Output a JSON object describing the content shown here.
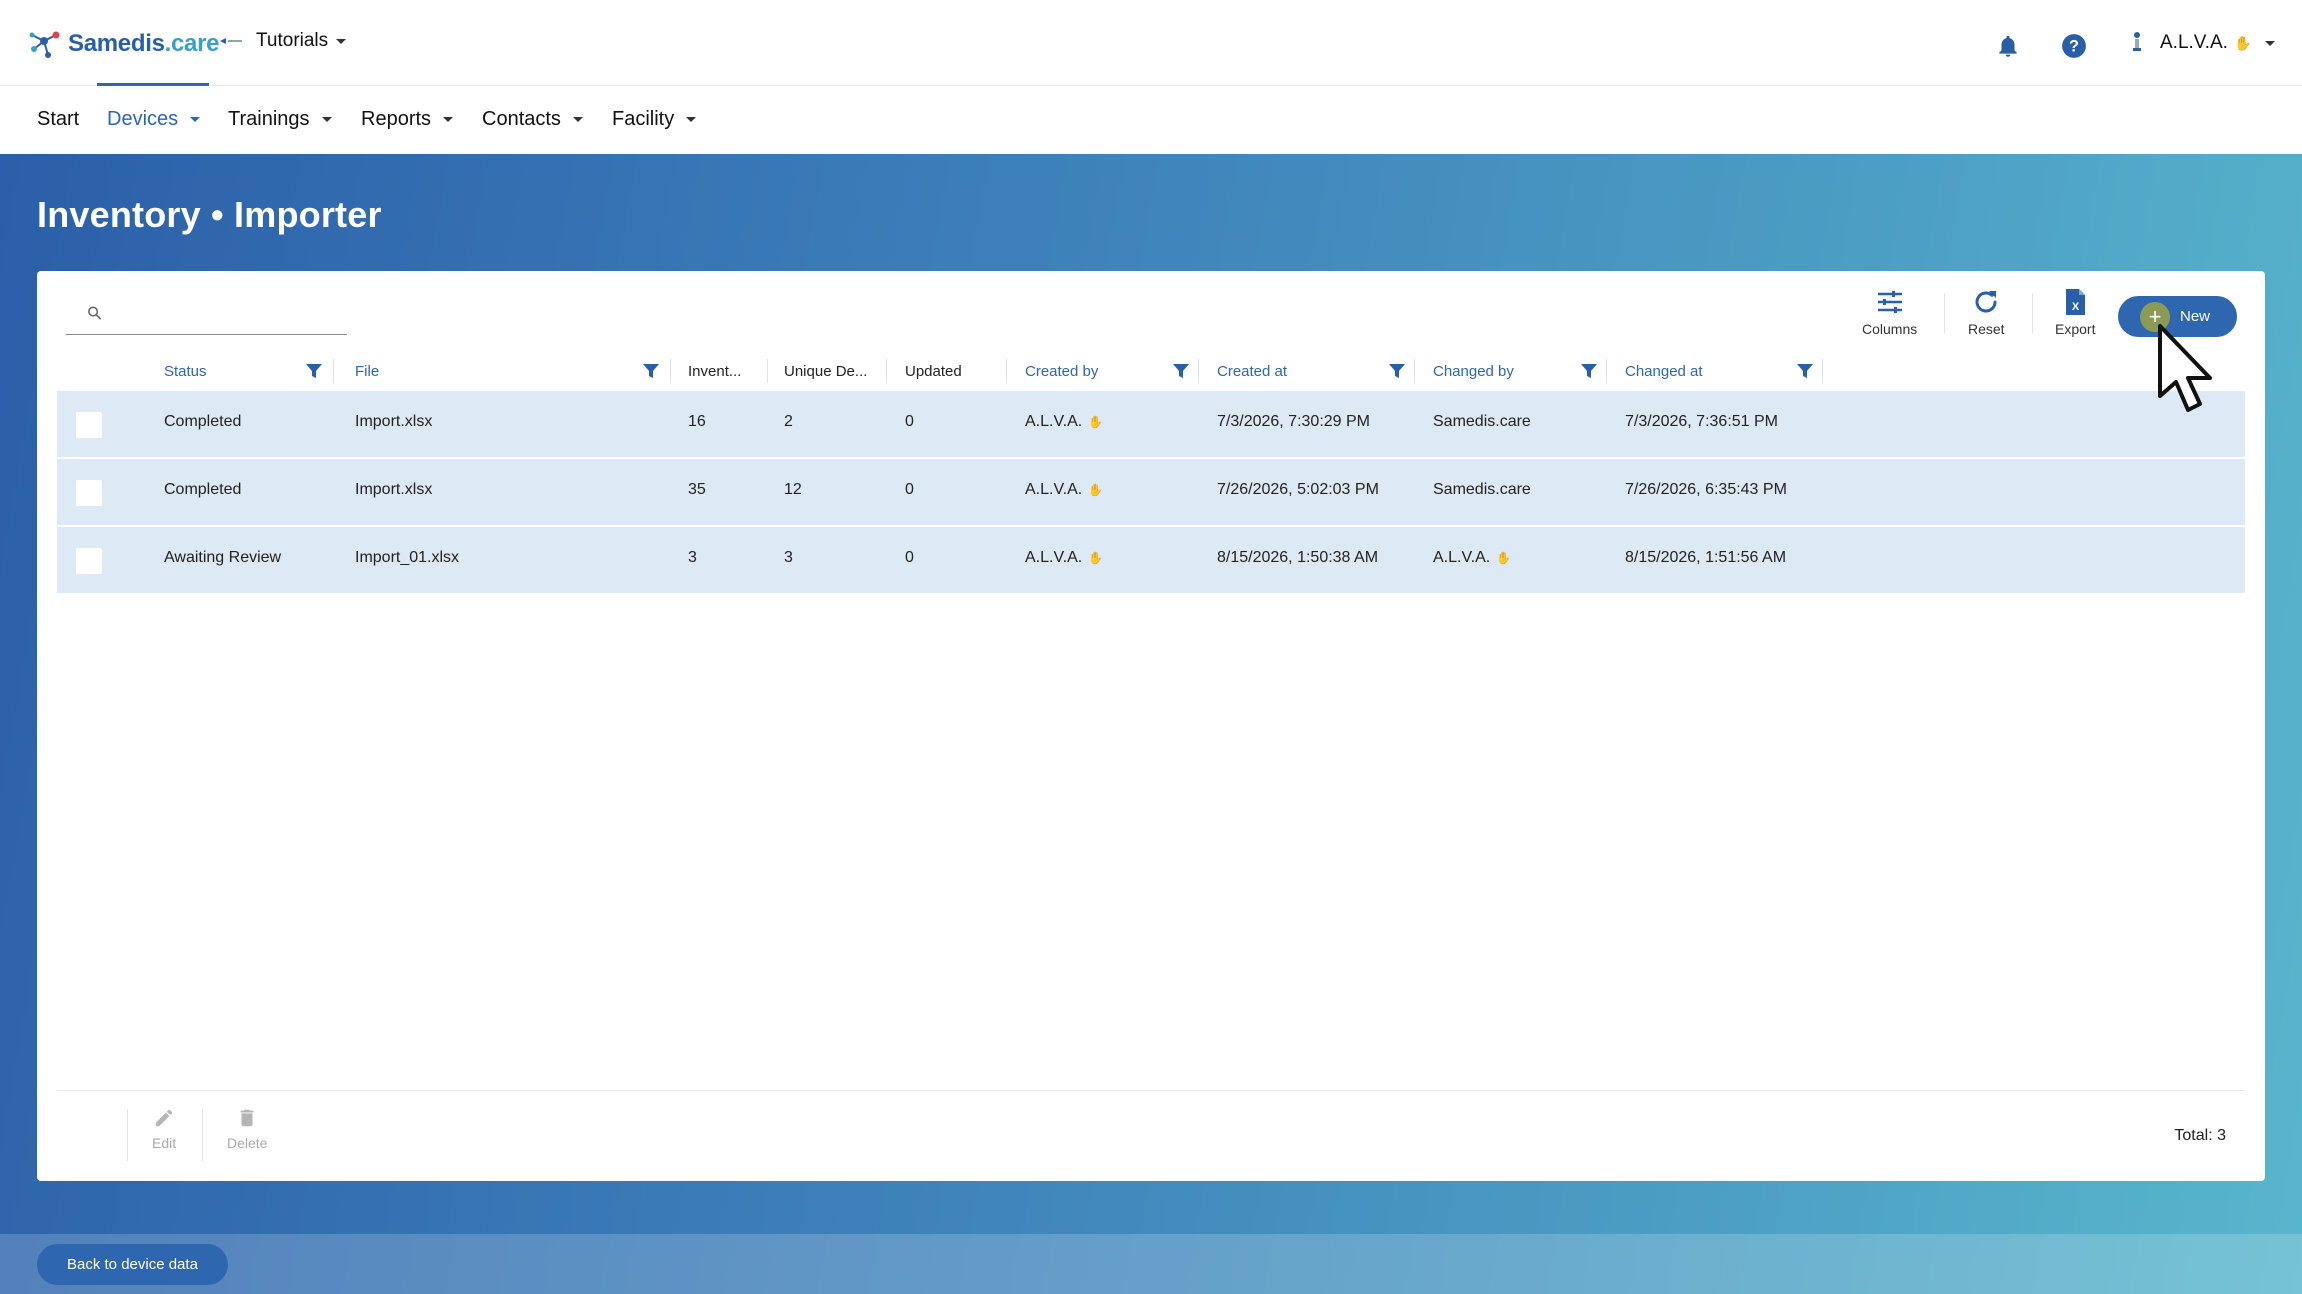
{
  "header": {
    "logo_main": "Samedis",
    "logo_dot": ".care",
    "tenant": "Tutorials",
    "user_name": "A.L.V.A.",
    "user_hand": "✋"
  },
  "nav": {
    "items": [
      "Start",
      "Devices",
      "Trainings",
      "Reports",
      "Contacts",
      "Facility"
    ],
    "active": "Devices"
  },
  "page": {
    "title": "Inventory • Importer"
  },
  "search": {
    "value": "",
    "placeholder": ""
  },
  "toolbar": {
    "columns": "Columns",
    "reset": "Reset",
    "export": "Export",
    "new": "New"
  },
  "table": {
    "columns": [
      "Status",
      "File",
      "Invent...",
      "Unique De...",
      "Updated",
      "Created by",
      "Created at",
      "Changed by",
      "Changed at"
    ],
    "rows": [
      {
        "status": "Completed",
        "file": "Import.xlsx",
        "inventory": "16",
        "unique": "2",
        "updated": "0",
        "created_by": "A.L.V.A.",
        "created_at": "7/3/2026, 7:30:29 PM",
        "changed_by": "Samedis.care",
        "changed_at": "7/3/2026, 7:36:51 PM"
      },
      {
        "status": "Completed",
        "file": "Import.xlsx",
        "inventory": "35",
        "unique": "12",
        "updated": "0",
        "created_by": "A.L.V.A.",
        "created_at": "7/26/2026, 5:02:03 PM",
        "changed_by": "Samedis.care",
        "changed_at": "7/26/2026, 6:35:43 PM"
      },
      {
        "status": "Awaiting Review",
        "file": "Import_01.xlsx",
        "inventory": "3",
        "unique": "3",
        "updated": "0",
        "created_by": "A.L.V.A.",
        "created_at": "8/15/2026, 1:50:38 AM",
        "changed_by": "A.L.V.A.",
        "changed_at": "8/15/2026, 1:51:56 AM"
      }
    ]
  },
  "footer": {
    "edit": "Edit",
    "delete": "Delete",
    "total": "Total: 3"
  },
  "bottom": {
    "back": "Back to device data"
  },
  "colors": {
    "brand_blue": "#2e66b0",
    "row_bg": "#dde9f5",
    "new_plus": "#8b9b57"
  }
}
